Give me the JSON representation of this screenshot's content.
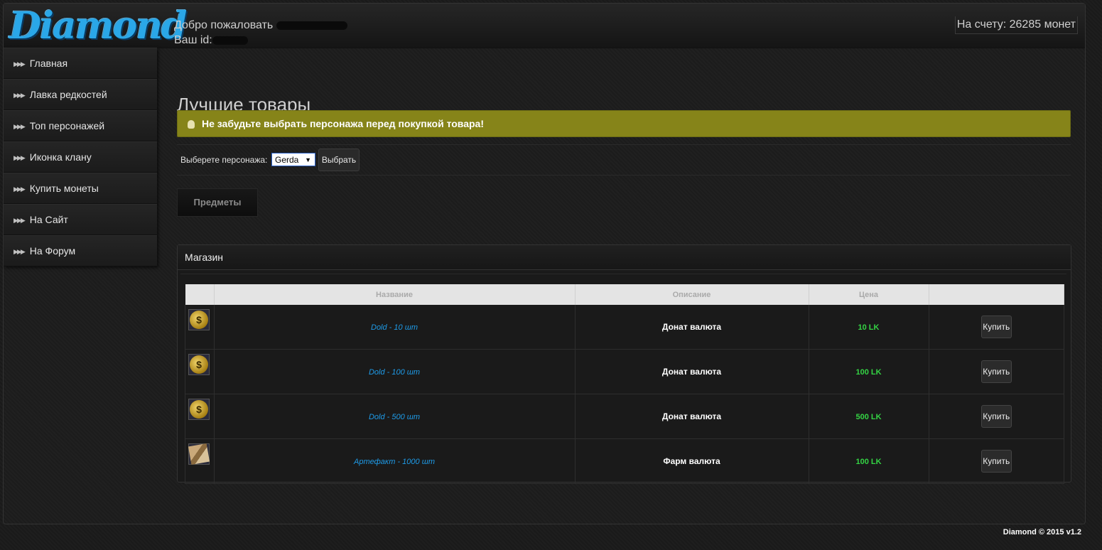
{
  "header": {
    "logo_text": "Diamond",
    "welcome_label": "Добро пожаловать",
    "id_label": "Ваш id:",
    "balance": "На счету: 26285 монет"
  },
  "sidebar": {
    "items": [
      {
        "label": "Главная"
      },
      {
        "label": "Лавка редкостей"
      },
      {
        "label": "Топ персонажей"
      },
      {
        "label": "Иконка клану"
      },
      {
        "label": "Купить монеты"
      },
      {
        "label": "На Сайт"
      },
      {
        "label": "На Форум"
      }
    ]
  },
  "main": {
    "title": "Лучшие товары",
    "alert": "Не забудьте выбрать персонажа перед покупкой товара!",
    "character": {
      "label": "Выберете персонажа:",
      "selected": "Gerda",
      "button": "Выбрать"
    },
    "tab_items": "Предметы"
  },
  "shop": {
    "title": "Магазин",
    "columns": [
      "",
      "Название",
      "Описание",
      "Цена",
      ""
    ],
    "rows": [
      {
        "icon": "coin-icon",
        "name": "Dold - 10 шт",
        "description": "Донат валюта",
        "price": "10 LK",
        "buy": "Купить"
      },
      {
        "icon": "coin-icon",
        "name": "Dold - 100 шт",
        "description": "Донат валюта",
        "price": "100 LK",
        "buy": "Купить"
      },
      {
        "icon": "coin-icon",
        "name": "Dold - 500 шт",
        "description": "Донат валюта",
        "price": "500 LK",
        "buy": "Купить"
      },
      {
        "icon": "scroll-icon",
        "name": "Артефакт - 1000 шт",
        "description": "Фарм валюта",
        "price": "100 LK",
        "buy": "Купить"
      }
    ]
  },
  "footer": {
    "text": "Diamond © 2015 v1.2"
  }
}
